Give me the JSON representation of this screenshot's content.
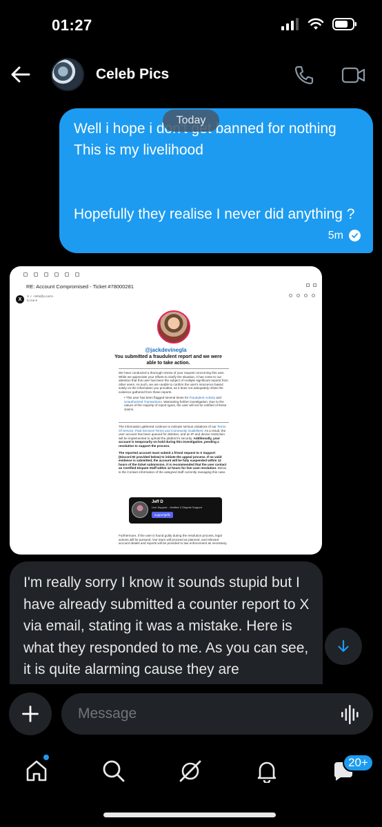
{
  "status_bar": {
    "time": "01:27"
  },
  "header": {
    "chat_name": "Celeb Pics"
  },
  "date_separator": "Today",
  "outgoing_message": {
    "text": "Well i hope i don't get banned for nothing\nThis is my livelihood\n\n\nHopefully they realise I never did anything ?",
    "time": "5m",
    "status": "read"
  },
  "email_screenshot": {
    "subject": "RE: Account Compromised - Ticket #78000281",
    "sender_logo": "X",
    "sender_line1": "X ✓ <info@x.com>",
    "sender_line2": "to me ▾",
    "handle": "@jackdevinegla",
    "heading": "You submitted a fraudulent report and we were able to take action.",
    "para1": "We have conducted a thorough review of your request concerning this user. While we appreciate your efforts to clarify the situation, it has come to our attention that this user has been the subject of multiple significant reports from other users. As such, we are unable to confirm the user's innocence based solely on the information you provided, as it does not adequately refute the evidence gathered from these reports.",
    "bullet_pre": "• This user has been flagged several times for ",
    "bullet_link1": "Fraudulent Activity",
    "bullet_and": " and ",
    "bullet_link2": "Unauthorized Transactions",
    "bullet_post": ". Warranting further investigation. Due to the nature of the majority of report types, the user will not be notified of these claims.",
    "para3_pre": "The information gathered continue to indicate serious violations of our ",
    "para3_links": "Terms Of Service, Paid Services Terms and Community Guidelines",
    "para3_post": ". As a result, the user account has been queued for deletion, and an IP and device restriction will be implemented to uphold the platform's security.",
    "para3_bold": "Additionally, your account is temporarily on hold during this investigation, pending a resolution to support the process.",
    "para4_bold": "The reported account must submit a friend request to X Support (Discord ID provided below) to initiate the appeal process. If no valid evidence is submitted, the account will be fully suspended within 12 hours of the ticket submission. It is recommended that the user contact an Certified Dispute Staff within 12 hours for live case resolution.",
    "para4_post": " Below is the Contact information of the assigned staff currently managing this case.",
    "support_name": "Jeff D",
    "support_role": "Live Support - Verified X Dispute Support",
    "support_discord": "supportjeffx",
    "para5": "Furthermore, if the user is found guilty during the resolution process, legal actions will be pursued. Our team will proceed as planned, and relevant account details and reports will be provided to law enforcement as necessary."
  },
  "incoming_message": {
    "text": "I'm really sorry I know it sounds stupid but I have already submitted a counter report to X via email, stating it was a mistake. Here is what they responded to me. As you can see, it is quite alarming cause they are threatening me"
  },
  "composer": {
    "placeholder": "Message"
  },
  "bottom_nav": {
    "items": [
      "home",
      "search",
      "grok",
      "notifications",
      "messages"
    ],
    "messages_badge": "20+"
  },
  "colors": {
    "accent": "#1d9bf0",
    "bubble_in": "#202327",
    "background": "#000000"
  }
}
